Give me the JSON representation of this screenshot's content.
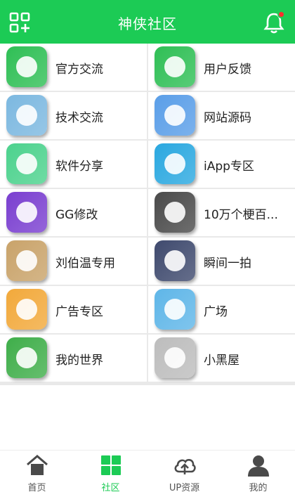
{
  "header": {
    "title": "神侠社区",
    "apps_icon": "grid-plus-icon",
    "bell_icon": "bell-icon"
  },
  "categories": [
    {
      "label": "官方交流",
      "icon": "official-icon",
      "color": "#2fbf55"
    },
    {
      "label": "用户反馈",
      "icon": "feedback-icon",
      "color": "#2fbf55"
    },
    {
      "label": "技术交流",
      "icon": "wrench-icon",
      "color": "#7cb8e0"
    },
    {
      "label": "网站源码",
      "icon": "code-file-icon",
      "color": "#5a9ee8"
    },
    {
      "label": "软件分享",
      "icon": "android-icon",
      "color": "#4cd28d"
    },
    {
      "label": "iApp专区",
      "icon": "iapp-icon",
      "color": "#2aa8e0"
    },
    {
      "label": "GG修改",
      "icon": "gg-icon",
      "color": "#7a3fd0"
    },
    {
      "label": "10万个梗百...",
      "icon": "meme-icon",
      "color": "#4a4a4a"
    },
    {
      "label": "刘伯温专用",
      "icon": "fortune-icon",
      "color": "#c9a36a"
    },
    {
      "label": "瞬间一拍",
      "icon": "camera-icon",
      "color": "#3f4a6e"
    },
    {
      "label": "广告专区",
      "icon": "ad-icon",
      "color": "#f2a93b"
    },
    {
      "label": "广场",
      "icon": "square-icon",
      "color": "#5fb6e8"
    },
    {
      "label": "我的世界",
      "icon": "minecraft-icon",
      "color": "#3fae4a"
    },
    {
      "label": "小黑屋",
      "icon": "jail-icon",
      "color": "#bdbdbd"
    }
  ],
  "tabs": [
    {
      "label": "首页",
      "icon": "home-icon"
    },
    {
      "label": "社区",
      "icon": "community-icon"
    },
    {
      "label": "UP资源",
      "icon": "cloud-upload-icon"
    },
    {
      "label": "我的",
      "icon": "user-icon"
    }
  ],
  "active_tab": "社区",
  "colors": {
    "accent": "#1ccb55",
    "badge": "#ff2d2d"
  }
}
